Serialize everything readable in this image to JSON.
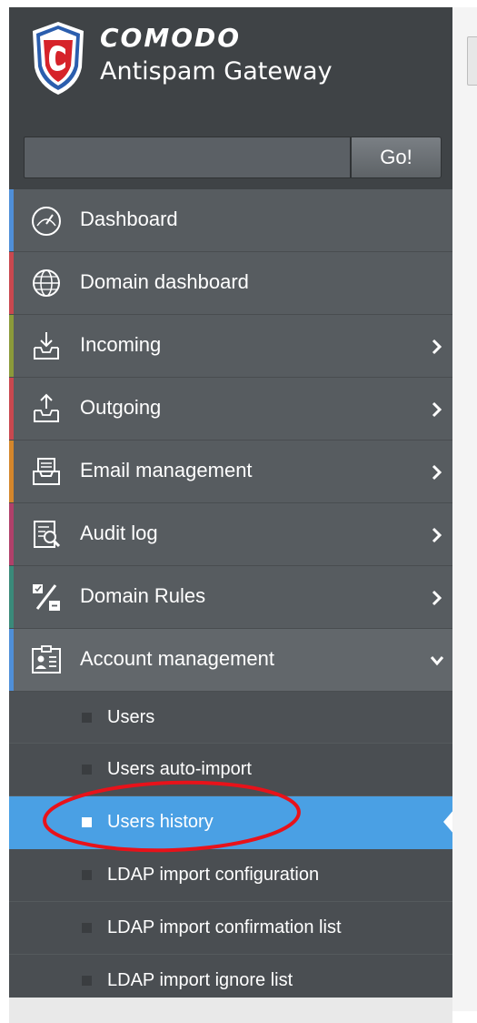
{
  "header": {
    "brand": "COMODO",
    "product": "Antispam Gateway",
    "logo_letter": "C"
  },
  "search": {
    "value": "",
    "placeholder": "",
    "button_label": "Go!"
  },
  "menu": {
    "items": [
      {
        "label": "Dashboard",
        "icon": "dashboard-gauge-icon",
        "accent": "#4f8fd8",
        "has_children": false
      },
      {
        "label": "Domain dashboard",
        "icon": "globe-icon",
        "accent": "#c9484f",
        "has_children": false
      },
      {
        "label": "Incoming",
        "icon": "inbox-download-icon",
        "accent": "#8b9a3a",
        "has_children": true
      },
      {
        "label": "Outgoing",
        "icon": "outbox-upload-icon",
        "accent": "#c9484f",
        "has_children": true
      },
      {
        "label": "Email management",
        "icon": "email-tray-icon",
        "accent": "#d4862b",
        "has_children": true
      },
      {
        "label": "Audit log",
        "icon": "audit-log-icon",
        "accent": "#b0406a",
        "has_children": true
      },
      {
        "label": "Domain Rules",
        "icon": "percent-rules-icon",
        "accent": "#3a8a7a",
        "has_children": true
      },
      {
        "label": "Account management",
        "icon": "account-card-icon",
        "accent": "#4f8fd8",
        "has_children": true,
        "expanded": true
      }
    ],
    "sub_items": [
      {
        "label": "Users",
        "active": false
      },
      {
        "label": "Users auto-import",
        "active": false
      },
      {
        "label": "Users history",
        "active": true
      },
      {
        "label": "LDAP import configuration",
        "active": false
      },
      {
        "label": "LDAP import confirmation list",
        "active": false
      },
      {
        "label": "LDAP import ignore list",
        "active": false
      }
    ]
  },
  "colors": {
    "sidebar_bg": "#575c60",
    "header_bg": "#3f4346",
    "active_bg": "#4aa0e4",
    "annotation": "#e8121a"
  }
}
